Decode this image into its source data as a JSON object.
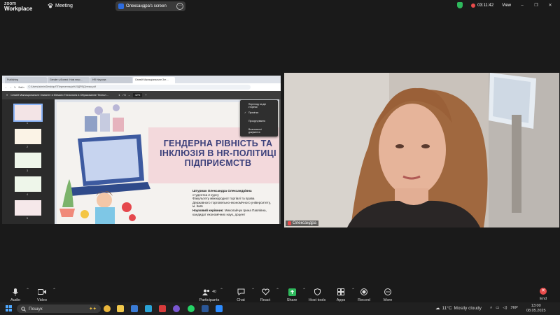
{
  "app": {
    "logo_line1": "zoom",
    "logo_line2": "Workplace",
    "meeting_label": "Meeting",
    "screen_share_label": "Олександра's screen",
    "timer": "03:11:42",
    "view_label": "View"
  },
  "browser": {
    "tabs": [
      "Publishing",
      "Gender у бізнесі: Нові перс…",
      "HR Наукова",
      "Семей Міжнаціональне Згл…"
    ],
    "url": "C:/Users/admin/Desktop/ПП/презентація%20ДРВ(2)тема.pdf",
    "url_prefix": "Файл"
  },
  "pdf": {
    "title": "Семей Міжнаціональне Знимнте в Мемати Технологія в Образованне Технол…",
    "page": "1",
    "page_total": "/ 5",
    "zoom": "42%",
    "thumb_numbers": [
      "1",
      "2",
      "3",
      "4",
      "5"
    ]
  },
  "context_menu": {
    "items": [
      "Перегляд на дві сторінки",
      "Примітки",
      "Прокручування",
      "Властивості документа"
    ],
    "checked_index": 1
  },
  "slide": {
    "title_line1": "ГЕНДЕРНА РІВНІСТЬ ТА",
    "title_line2": "ІНКЛЮЗІЯ В HR-ПОЛІТИЦІ",
    "title_line3": "ПІДПРИЄМСТВ",
    "author_name": "Штурмак Олександра Олександрівна",
    "author_lines": [
      "студентка 2 курсу",
      "Факультету міжнародної торгівлі та права",
      "Державного торговельно-економічного університету,",
      "м. Київ"
    ],
    "supervisor_label": "Науковий керівник:",
    "supervisor_name": "Миколайчук Ірина Павлівна,",
    "supervisor_title": "кандидат економічних наук, доцент"
  },
  "camera": {
    "participant_name": "Олександра"
  },
  "toolbar": {
    "audio": "Audio",
    "video": "Video",
    "participants": "Participants",
    "participants_count": "40",
    "chat": "Chat",
    "react": "React",
    "share": "Share",
    "host_tools": "Host tools",
    "apps": "Apps",
    "record": "Record",
    "more": "More",
    "end": "End"
  },
  "taskbar": {
    "search": "Пошук",
    "temperature": "11°C",
    "weather": "Mostly cloudy",
    "lang": "УКР",
    "time": "13:00",
    "date": "08.05.2025"
  },
  "colors": {
    "accent_green": "#2eb85c",
    "end_red": "#e94b4b",
    "slide_title": "#3a3f7a",
    "slide_pink": "#f3d9dc"
  }
}
